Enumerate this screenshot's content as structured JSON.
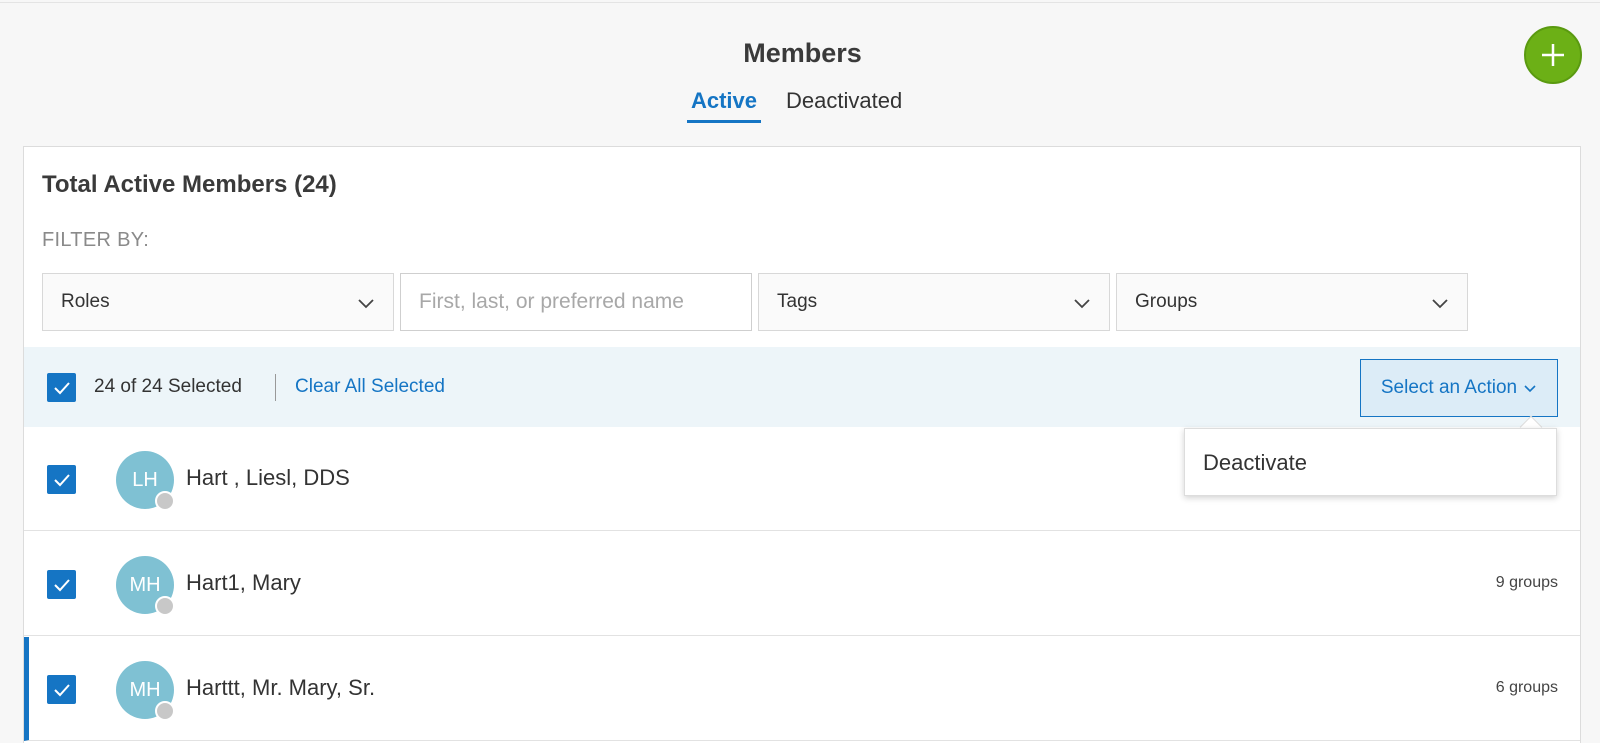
{
  "header": {
    "title": "Members",
    "tabs": [
      {
        "label": "Active",
        "active": true
      },
      {
        "label": "Deactivated",
        "active": false
      }
    ],
    "add_button_icon": "plus-icon"
  },
  "panel": {
    "title": "Total Active Members (24)",
    "filter_label": "FILTER BY:",
    "filters": {
      "roles": "Roles",
      "name_placeholder": "First, last, or preferred name",
      "tags": "Tags",
      "groups": "Groups"
    }
  },
  "bulk": {
    "selected_text": "24 of 24 Selected",
    "clear_label": "Clear All Selected",
    "action_label": "Select an Action"
  },
  "action_menu": {
    "items": [
      "Deactivate"
    ]
  },
  "members": [
    {
      "initials": "LH",
      "name": "Hart , Liesl, DDS",
      "groups": ""
    },
    {
      "initials": "MH",
      "name": "Hart1, Mary",
      "groups": "9 groups"
    },
    {
      "initials": "MH",
      "name": "Harttt, Mr. Mary, Sr.",
      "groups": "6 groups"
    }
  ],
  "colors": {
    "accent": "#1575c4",
    "fab": "#6cb016",
    "avatar": "#7fc1d3",
    "bulk_bar": "#edf5f9"
  }
}
